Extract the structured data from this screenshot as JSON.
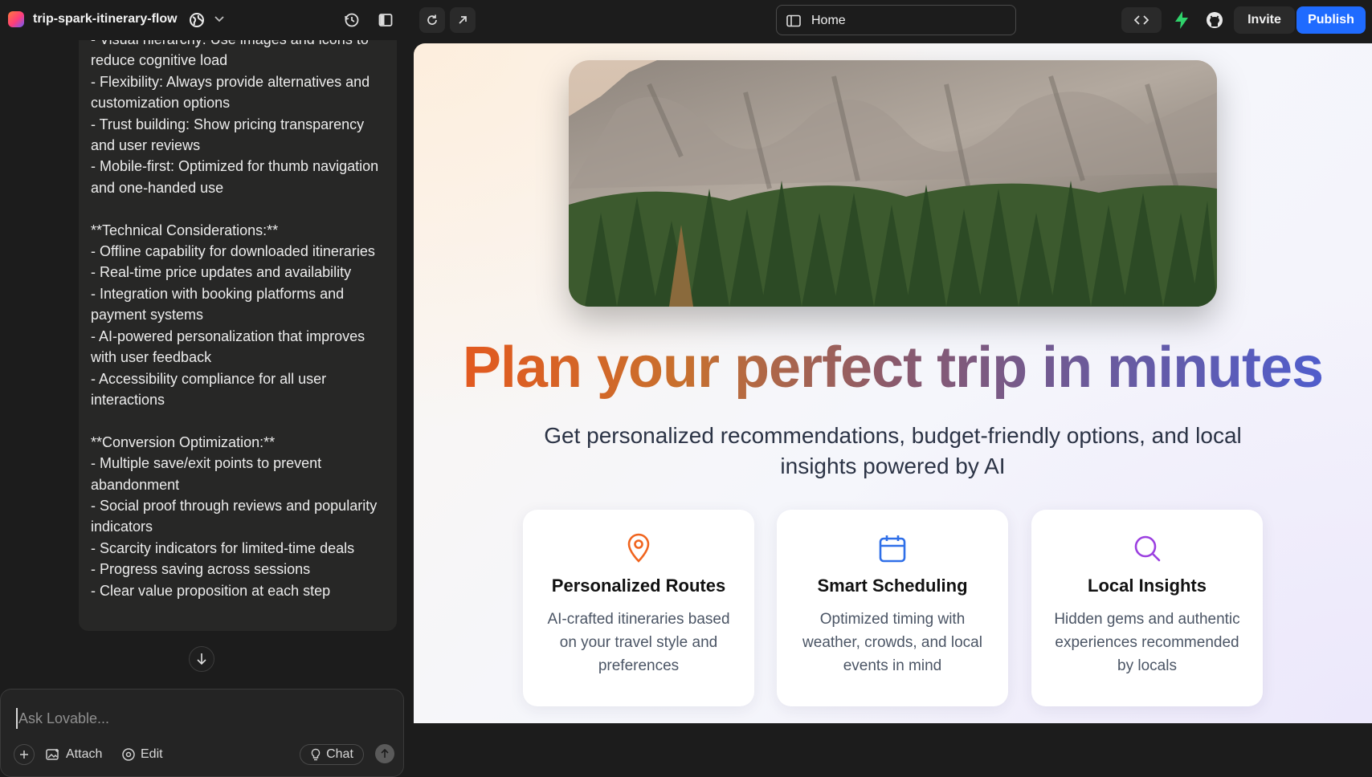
{
  "project": {
    "name": "trip-spark-itinerary-flow"
  },
  "toolbar": {
    "url_label": "Home",
    "invite_label": "Invite",
    "publish_label": "Publish"
  },
  "chat": {
    "message_text": "- Visual hierarchy: Use images and icons to reduce cognitive load\n- Flexibility: Always provide alternatives and customization options\n- Trust building: Show pricing transparency and user reviews\n- Mobile-first: Optimized for thumb navigation and one-handed use\n\n**Technical Considerations:**\n- Offline capability for downloaded itineraries\n- Real-time price updates and availability\n- Integration with booking platforms and payment systems\n- AI-powered personalization that improves with user feedback\n- Accessibility compliance for all user interactions\n\n**Conversion Optimization:**\n- Multiple save/exit points to prevent abandonment\n- Social proof through reviews and popularity indicators\n- Scarcity indicators for limited-time deals\n- Progress saving across sessions\n- Clear value proposition at each step",
    "composer_placeholder": "Ask Lovable...",
    "attach_label": "Attach",
    "edit_label": "Edit",
    "chat_label": "Chat"
  },
  "preview": {
    "headline": "Plan your perfect trip in minutes",
    "subheadline": "Get personalized recommendations, budget-friendly options, and local insights powered by AI",
    "features": [
      {
        "title": "Personalized Routes",
        "description": "AI-crafted itineraries based on your travel style and preferences",
        "icon": "map-pin-icon",
        "color": "#f0641e"
      },
      {
        "title": "Smart Scheduling",
        "description": "Optimized timing with weather, crowds, and local events in mind",
        "icon": "calendar-icon",
        "color": "#2f6fe8"
      },
      {
        "title": "Local Insights",
        "description": "Hidden gems and authentic experiences recommended by locals",
        "icon": "search-icon",
        "color": "#9b3fe0"
      }
    ]
  },
  "colors": {
    "accent": "#1f6bff",
    "lightning": "#2fd36b"
  }
}
